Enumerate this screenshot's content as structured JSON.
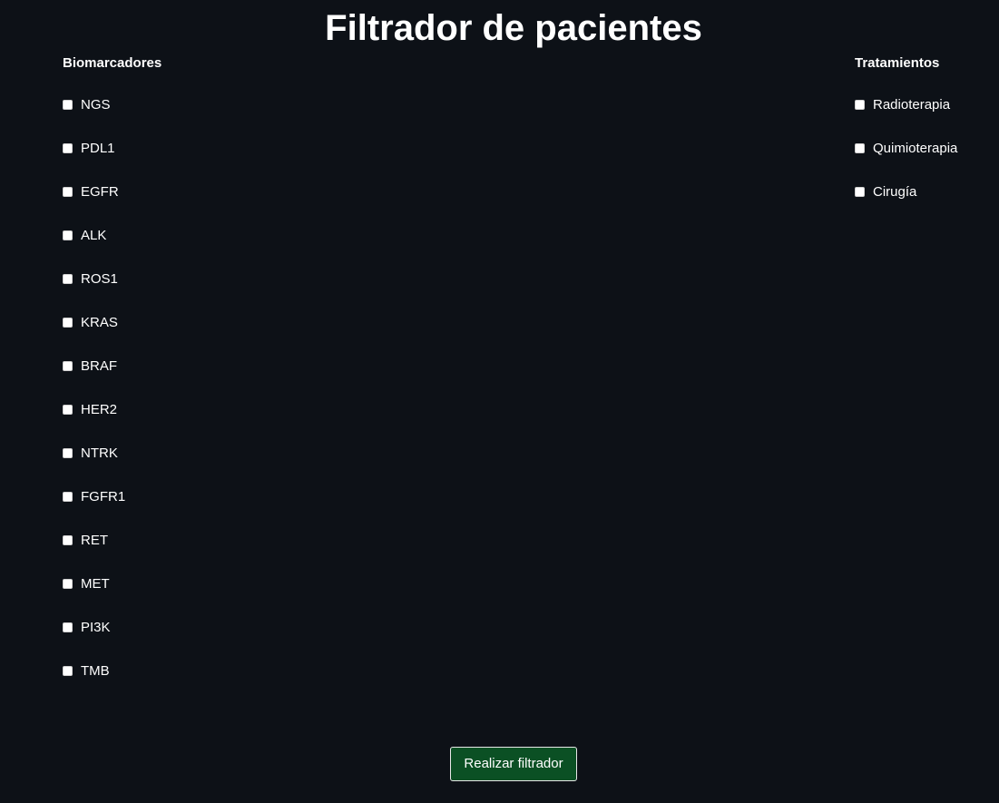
{
  "page": {
    "title": "Filtrador de pacientes"
  },
  "biomarkers": {
    "heading": "Biomarcadores",
    "items": [
      {
        "label": "NGS",
        "checked": false
      },
      {
        "label": "PDL1",
        "checked": false
      },
      {
        "label": "EGFR",
        "checked": false
      },
      {
        "label": "ALK",
        "checked": false
      },
      {
        "label": "ROS1",
        "checked": false
      },
      {
        "label": "KRAS",
        "checked": false
      },
      {
        "label": "BRAF",
        "checked": false
      },
      {
        "label": "HER2",
        "checked": false
      },
      {
        "label": "NTRK",
        "checked": false
      },
      {
        "label": "FGFR1",
        "checked": false
      },
      {
        "label": "RET",
        "checked": false
      },
      {
        "label": "MET",
        "checked": false
      },
      {
        "label": "PI3K",
        "checked": false
      },
      {
        "label": "TMB",
        "checked": false
      }
    ]
  },
  "treatments": {
    "heading": "Tratamientos",
    "items": [
      {
        "label": "Radioterapia",
        "checked": false
      },
      {
        "label": "Quimioterapia",
        "checked": false
      },
      {
        "label": "Cirugía",
        "checked": false
      }
    ]
  },
  "actions": {
    "submit_label": "Realizar filtrador"
  },
  "colors": {
    "background": "#0d1117",
    "text": "#ffffff",
    "button_background": "#0b5024"
  }
}
